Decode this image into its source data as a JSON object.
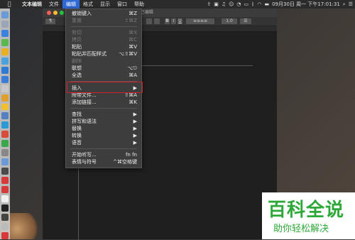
{
  "menubar": {
    "app_name": "文本编辑",
    "items": [
      "文件",
      "编辑",
      "格式",
      "显示",
      "窗口",
      "帮助"
    ],
    "active": "编辑",
    "datetime": "09月30日 周一 下午17:01:31"
  },
  "window": {
    "title": "未命名 — 已编辑",
    "style_select": "¶",
    "size_select": "1.0"
  },
  "menu": {
    "items": [
      {
        "label": "撤销键入",
        "shortcut": "⌘Z",
        "state": "bright"
      },
      {
        "label": "重做",
        "shortcut": "⇧⌘Z",
        "state": "dim"
      },
      {
        "label": "剪切",
        "shortcut": "⌘X",
        "state": "dim"
      },
      {
        "label": "拷贝",
        "shortcut": "⌘C",
        "state": "dim"
      },
      {
        "label": "粘贴",
        "shortcut": "⌘V",
        "state": "bright"
      },
      {
        "label": "粘贴并匹配样式",
        "shortcut": "⌥⇧⌘V",
        "state": "bright"
      },
      {
        "label": "删除",
        "shortcut": "",
        "state": "dim"
      },
      {
        "label": "联想",
        "shortcut": "⌥⎋",
        "state": "bright"
      },
      {
        "label": "全选",
        "shortcut": "⌘A",
        "state": "bright"
      },
      {
        "label": "插入",
        "shortcut": "▶",
        "state": "bright"
      },
      {
        "label": "附带文件...",
        "shortcut": "⇧⌘A",
        "state": "bright"
      },
      {
        "label": "添加链接...",
        "shortcut": "⌘K",
        "state": "bright"
      },
      {
        "label": "查找",
        "shortcut": "▶",
        "state": "bright"
      },
      {
        "label": "拼写和语法",
        "shortcut": "▶",
        "state": "bright"
      },
      {
        "label": "替换",
        "shortcut": "▶",
        "state": "bright"
      },
      {
        "label": "转换",
        "shortcut": "▶",
        "state": "bright"
      },
      {
        "label": "语音",
        "shortcut": "▶",
        "state": "bright"
      },
      {
        "label": "开始听写...",
        "shortcut": "fn fn",
        "state": "bright"
      },
      {
        "label": "表情与符号",
        "shortcut": "^⌘空格键",
        "state": "bright"
      }
    ]
  },
  "watermark": {
    "title": "百科全说",
    "subtitle": "助你轻松解决"
  },
  "colors": {
    "accent": "#2d6ad8",
    "highlight_box": "#d0202a",
    "watermark_green": "#2fa83a"
  }
}
